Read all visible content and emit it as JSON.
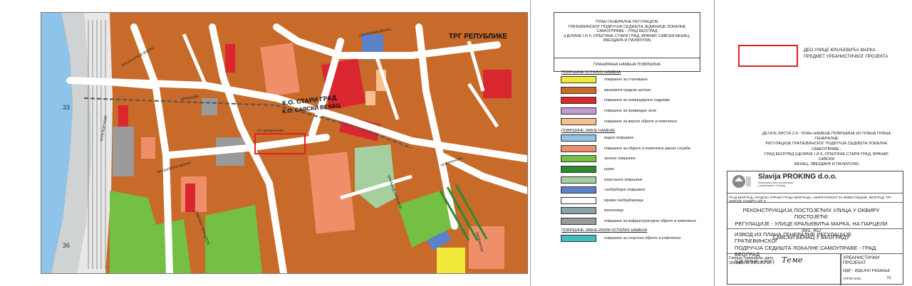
{
  "map": {
    "square_label": "ТРГ РЕПУБЛИКЕ",
    "stari_grad": "К.О. СТАРИ ГРАД",
    "savski_venac": "К.О. САВСКИ ВЕНАЦ",
    "streets": {
      "obilicev": "ОБИЛИЋЕВ ВЕНАЦ",
      "brankova": "БРАНКОВА",
      "jug_bogdanova": "ЈУГ-БОГДАНОВА",
      "prizrenska": "ПРИЗРЕНСКА",
      "kraljevica_marka": "КРАЉЕВИЋА МАРКА",
      "gavrila_principa": "ГАВРИЛА ПРИНЦИПА",
      "kralja_milana": "КРАЉИЦЕ НАТАЛИЈЕ",
      "balkanska": "БАЛКАНСКА",
      "karadjordjeva": "КАРАЂОРЂЕВА",
      "kosancicev": "КОСАНЧИЋЕВ ВЕНАЦ"
    },
    "grid_marks": [
      "33",
      "36"
    ]
  },
  "legend_header": {
    "title_lines": [
      "ПЛАН ГЕНЕРАЛНЕ РЕГУЛАЦИЈЕ",
      "ГРАЂЕВИНСКОГ ПОДРУЧЈА СЕДИШТА ЈЕДИНИЦЕ ЛОКАЛНЕ",
      "САМОУПРАВЕ - ГРАД БЕОГРАД",
      "(ЦЕЛИНЕ I И II, ОПШТИНЕ СТАРИ ГРАД, ВРАЧАР, САВСКИ ВЕНАЦ,",
      "ЗВЕЗДАРА И ПАЛИЛУЛА)"
    ],
    "subtitle": "ПЛАНИРАНА НАМЕНА ПОВРШИНА"
  },
  "legend": {
    "group_other": "ПОВРШИНЕ ОСТАЛИХ НАМЕНА",
    "group_public": "ПОВРШИНЕ ЈАВНЕ НАМЕНЕ",
    "group_mixed": "ПОВРШИНЕ ЈАВНЕ И/ИЛИ ОСТАЛИХ НАМЕНА",
    "other_items": [
      {
        "label": "површине за становање",
        "color": "#f2ea3a"
      },
      {
        "label": "мешовити градски центри",
        "color": "#c76a2a"
      },
      {
        "label": "површине за комерцијалне садржаје",
        "color": "#d9262f"
      },
      {
        "label": "површине за привредне зоне",
        "color": "#c39ad6"
      },
      {
        "label": "површине за верске објекте и комплексе",
        "color": "#f7c08f"
      }
    ],
    "public_items": [
      {
        "label": "водне површине",
        "color": "#8ec3ea"
      },
      {
        "label": "површине за објекте и комплексе јавних служби",
        "color": "#ef8f6a"
      },
      {
        "label": "зелене површине",
        "color": "#74c043"
      },
      {
        "label": "шуме",
        "color": "#2f8a2f"
      },
      {
        "label": "комуналне површине",
        "color": "#a6cfa0"
      },
      {
        "label": "саобраћајне површине",
        "color": "#5b82c9"
      },
      {
        "label": "мрежа саобраћајница",
        "color": "#ffffff"
      },
      {
        "label": "железница",
        "color": "#8aa3a8"
      },
      {
        "label": "површине за инфраструктурне објекте и комплексе",
        "color": "#9a9a9a"
      }
    ],
    "mixed_items": [
      {
        "label": "површине за спортске објекте и комплексе",
        "color": "#3fbfc0"
      }
    ]
  },
  "marker": {
    "line1": "ДЕО УЛИЦЕ КРАЉЕВИЋА МАРКА",
    "line2": "ПРЕДМЕТ УРБАНИСТИЧКОГ ПРОЈЕКТА",
    "color": "#e02020"
  },
  "detail": {
    "lines": [
      "ДЕТАЉ ЛИСТА 2.4 - ПЛАН НАМЕНЕ ПОВРШИНА ИЗ ПЛАНА ПЛАНА ГЕНЕРАЛНЕ",
      "РЕГУЛАЦИЈЕ ГРАЂЕВИНСКОГ ПОДРУЧЈА СЕДИШТА ЛОКАЛНЕ САМОУПРАВЕ -",
      "ГРАД БЕОГРАД (ЦЕЛИНЕ I И II, ОПШТИНЕ СТАРИ ГРАД, ВРАЧАР, САВСКИ",
      "ВЕНАЦ, ЗВЕЗДАРА И ПАЛИЛУЛА)"
    ]
  },
  "title_block": {
    "company": "Slavija PROKING d.o.o.",
    "company_sub": [
      "Инжењерски биро за урбанизам",
      "и пројектовање, Београд"
    ],
    "address": "ГРАД БЕОГРАД, ГРАДСКА УПРАВА ГРАДА БЕОГРАДА, СЕКРЕТАРИЈАТ ЗА ИНВЕСТИЦИЈЕ, БЕОГРАД, ТРГ НИКОЛЕ ПАШИЋА БР. 6",
    "project_lines": [
      "РЕКОНСТРУКЦИЈА ПОСТОЈЕЋИХ УЛИЦА У ОКВИРУ ПОСТОЈЕЋЕ",
      "РЕГУЛАЦИЈЕ - УЛИЦЕ КРАЉЕВИЋА МАРКА, НА ПАРЦЕЛИ 391, КО",
      "САВСКИ ВЕНАЦ У БЕОГРАДУ"
    ],
    "doc_lines": [
      "ИЗВОД ИЗ ПЛАНА ГЕНЕРАЛНЕ РЕГУЛАЦИЈЕ ГРАЂЕВИНСКОГ",
      "ПОДРУЧЈА СЕДИШТА ЛОКАЛНЕ САМОУПРАВЕ - ГРАД БЕОГРАД",
      "(ЦЕЛИНЕ I-XIX)"
    ],
    "sign_name": "Синиша Темеринско, дипл",
    "sign_lic": "200 0065 03, 300 3152 03",
    "signature": "Теме",
    "phase_label": "УРБАНИСТИЧКИ ПРОЈЕКАТ",
    "phase2": "ИДР - ИДЕЈНО РЕШЕЊЕ",
    "date": "АПРИЛ 2022.",
    "sheet": "01"
  }
}
